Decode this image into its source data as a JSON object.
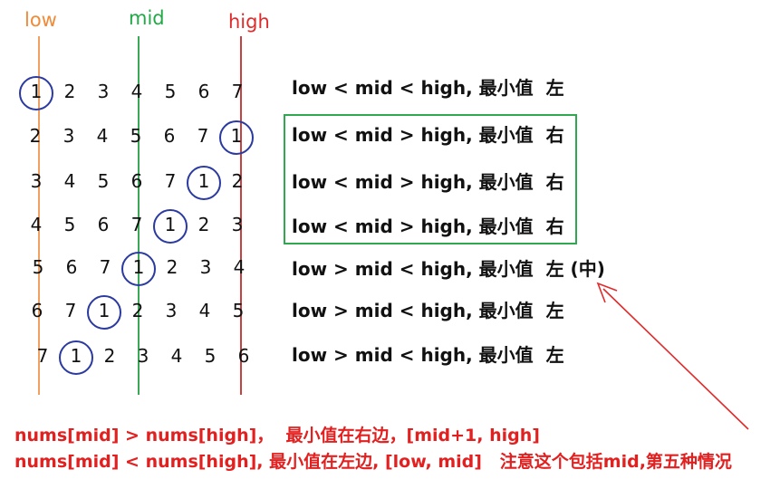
{
  "labels": {
    "low": "low",
    "mid": "mid",
    "high": "high"
  },
  "rows": [
    {
      "nums": [
        "1",
        "2",
        "3",
        "4",
        "5",
        "6",
        "7"
      ],
      "circle": 0,
      "desc": "low < mid < high, 最小值  左"
    },
    {
      "nums": [
        "2",
        "3",
        "4",
        "5",
        "6",
        "7",
        "1"
      ],
      "circle": 6,
      "desc": "low < mid > high, 最小值  右"
    },
    {
      "nums": [
        "3",
        "4",
        "5",
        "6",
        "7",
        "1",
        "2"
      ],
      "circle": 5,
      "desc": "low < mid > high, 最小值  右"
    },
    {
      "nums": [
        "4",
        "5",
        "6",
        "7",
        "1",
        "2",
        "3"
      ],
      "circle": 4,
      "desc": "low < mid > high, 最小值  右"
    },
    {
      "nums": [
        "5",
        "6",
        "7",
        "1",
        "2",
        "3",
        "4"
      ],
      "circle": 3,
      "desc": "low > mid < high, 最小值  左 (中)"
    },
    {
      "nums": [
        "6",
        "7",
        "1",
        "2",
        "3",
        "4",
        "5"
      ],
      "circle": 2,
      "desc": "low > mid < high, 最小值  左"
    },
    {
      "nums": [
        "7",
        "1",
        "2",
        "3",
        "4",
        "5",
        "6"
      ],
      "circle": 1,
      "desc": "low > mid < high, 最小值  左"
    }
  ],
  "notes": {
    "line1": "nums[mid] > nums[high]，  最小值在右边，[mid+1, high]",
    "line2": "nums[mid] < nums[high], 最小值在左边, [low, mid]   注意这个包括mid,第五种情况"
  },
  "colors": {
    "low": "#f08a38",
    "mid": "#1faa45",
    "high": "#e02b2b",
    "circle": "#2a3aa0",
    "box": "#2fa84f",
    "note": "#e22020"
  }
}
